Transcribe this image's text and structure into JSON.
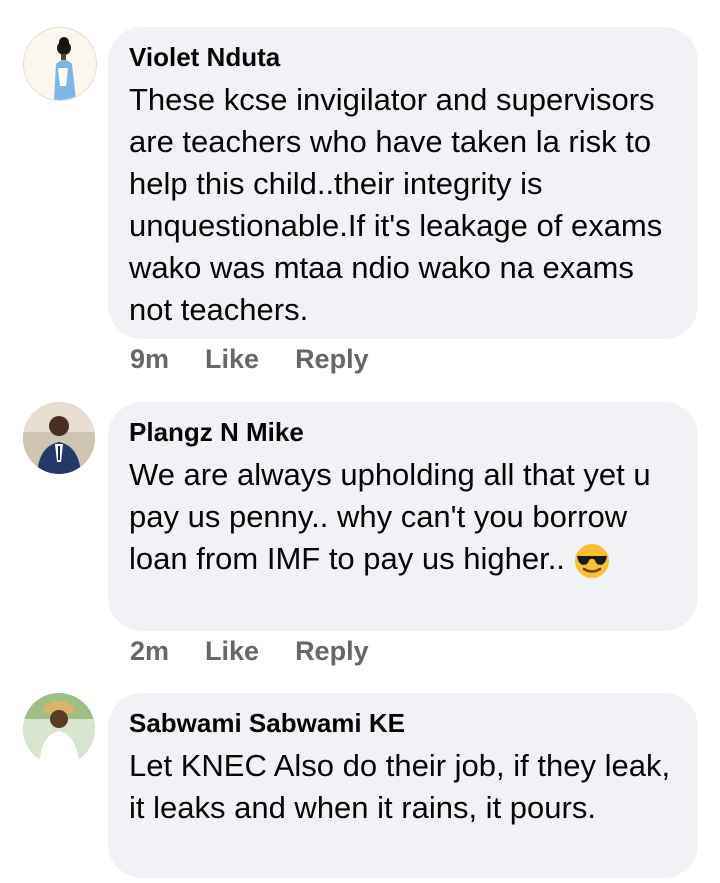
{
  "comments": [
    {
      "author": "Violet Nduta",
      "text": "These kcse invigilator and supervisors are teachers who have taken la risk to help this child..their integrity is unquestionable.If it's leakage of exams wako was mtaa ndio wako na exams not teachers.",
      "time": "9m",
      "like": "Like",
      "reply": "Reply"
    },
    {
      "author": "Plangz N Mike",
      "text": "We are always upholding all that yet u pay us penny.. why can't you borrow loan from IMF to pay us higher..",
      "emoji": "smiling-face-with-sunglasses",
      "time": "2m",
      "like": "Like",
      "reply": "Reply"
    },
    {
      "author": "Sabwami Sabwami KE",
      "text": "Let KNEC Also do their job, if they leak, it leaks and when it rains, it pours."
    }
  ],
  "colors": {
    "bubble": "#f0f2f5",
    "text": "#050505",
    "meta": "#65676b"
  }
}
